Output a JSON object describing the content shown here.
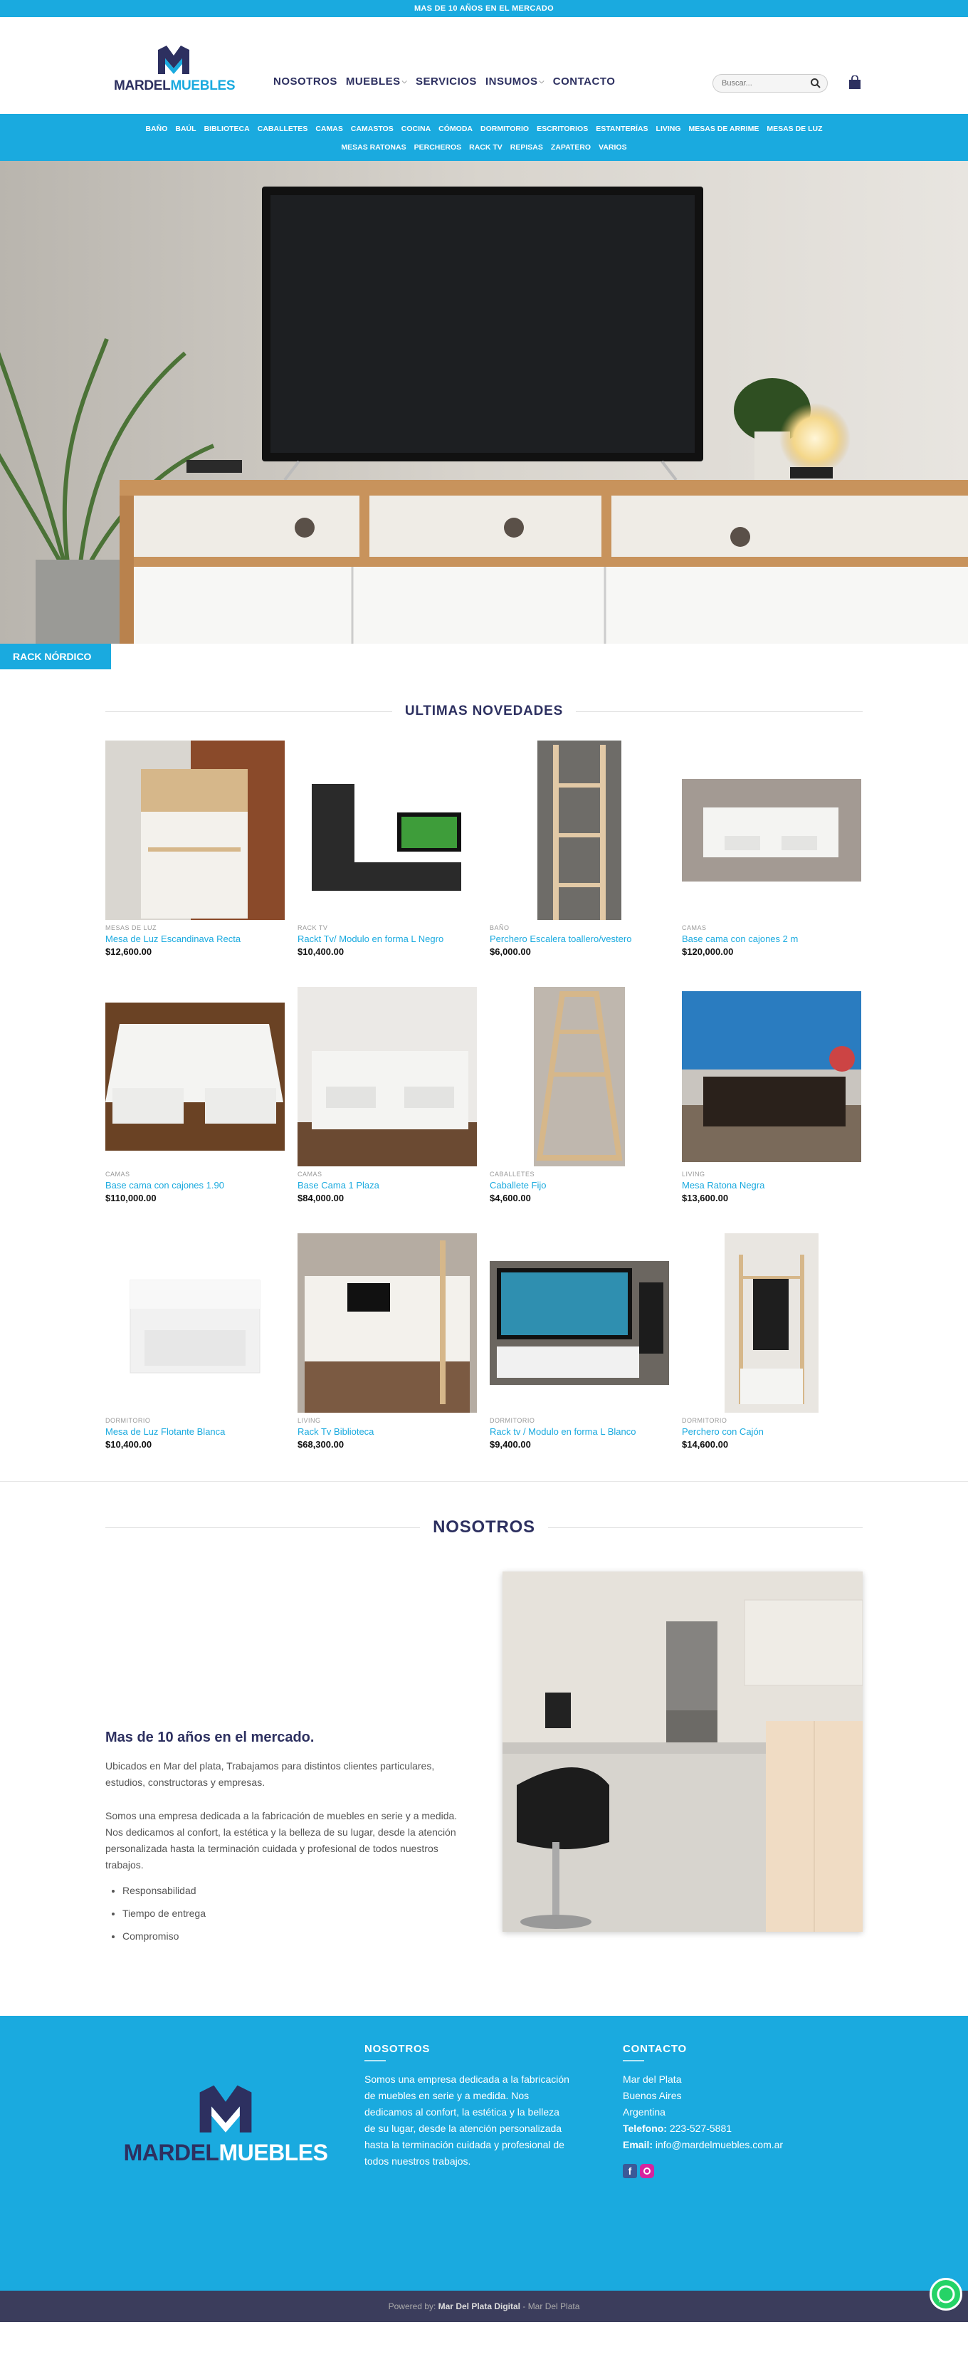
{
  "topbar": {
    "text": "MAS DE 10 AÑOS EN EL MERCADO"
  },
  "brand": {
    "part1": "MARDEL",
    "part2": "MUEBLES",
    "colors": {
      "navy": "#2d3060",
      "blue": "#1aaadf"
    }
  },
  "nav": {
    "items": [
      {
        "label": "NOSOTROS",
        "has_dropdown": false
      },
      {
        "label": "MUEBLES",
        "has_dropdown": true
      },
      {
        "label": "SERVICIOS",
        "has_dropdown": false
      },
      {
        "label": "INSUMOS",
        "has_dropdown": true
      },
      {
        "label": "CONTACTO",
        "has_dropdown": false
      }
    ],
    "search_placeholder": "Buscar...",
    "search_icon": "search-icon",
    "cart_icon": "shopping-bag-icon"
  },
  "categories": {
    "row1": [
      "BAÑO",
      "BAÚL",
      "BIBLIOTECA",
      "CABALLETES",
      "CAMAS",
      "CAMASTOS",
      "COCINA",
      "CÓMODA",
      "DORMITORIO",
      "ESCRITORIOS",
      "ESTANTERÍAS",
      "LIVING",
      "MESAS DE ARRIME",
      "MESAS DE LUZ"
    ],
    "row2": [
      "MESAS RATONAS",
      "PERCHEROS",
      "RACK TV",
      "REPISAS",
      "ZAPATERO",
      "VARIOS"
    ]
  },
  "hero": {
    "tag": "RACK NÓRDICO"
  },
  "latest": {
    "title": "ULTIMAS NOVEDADES",
    "products": [
      {
        "category": "MESAS DE LUZ",
        "name": "Mesa de Luz Escandinava Recta",
        "price": "$12,600.00"
      },
      {
        "category": "RACK TV",
        "name": "Rackt Tv/ Modulo en forma L Negro",
        "price": "$10,400.00"
      },
      {
        "category": "BAÑO",
        "name": "Perchero Escalera toallero/vestero",
        "price": "$6,000.00"
      },
      {
        "category": "CAMAS",
        "name": "Base cama con cajones 2 m",
        "price": "$120,000.00"
      },
      {
        "category": "CAMAS",
        "name": "Base cama con cajones 1.90",
        "price": "$110,000.00"
      },
      {
        "category": "CAMAS",
        "name": "Base Cama 1 Plaza",
        "price": "$84,000.00"
      },
      {
        "category": "CABALLETES",
        "name": "Caballete Fijo",
        "price": "$4,600.00"
      },
      {
        "category": "LIVING",
        "name": "Mesa Ratona Negra",
        "price": "$13,600.00"
      },
      {
        "category": "DORMITORIO",
        "name": "Mesa de Luz Flotante Blanca",
        "price": "$10,400.00"
      },
      {
        "category": "LIVING",
        "name": "Rack Tv Biblioteca",
        "price": "$68,300.00"
      },
      {
        "category": "DORMITORIO",
        "name": "Rack tv / Modulo en forma L Blanco",
        "price": "$9,400.00"
      },
      {
        "category": "DORMITORIO",
        "name": "Perchero con Cajón",
        "price": "$14,600.00"
      }
    ]
  },
  "about": {
    "title": "NOSOTROS",
    "heading": "Mas de 10 años en el mercado.",
    "p1": "Ubicados en Mar del plata, Trabajamos para distintos clientes particulares, estudios, constructoras y empresas.",
    "p2": "Somos una empresa dedicada a la fabricación de muebles en serie y a medida. Nos dedicamos al confort, la estética y la belleza de su lugar, desde la atención personalizada hasta la terminación cuidada y profesional de todos nuestros trabajos.",
    "bullets": [
      "Responsabilidad",
      "Tiempo de entrega",
      "Compromiso"
    ]
  },
  "footer": {
    "nosotros_title": "NOSOTROS",
    "nosotros_text": "Somos una empresa dedicada a la fabricación de muebles en serie y a medida. Nos dedicamos al confort, la estética y la belleza de su lugar, desde la atención personalizada hasta la terminación cuidada y profesional de todos nuestros trabajos.",
    "contacto_title": "CONTACTO",
    "city": "Mar del Plata",
    "province": "Buenos Aires",
    "country": "Argentina",
    "phone_label": "Telefono:",
    "phone": "223-527-5881",
    "email_label": "Email:",
    "email": "info@mardelmuebles.com.ar",
    "social_icons": [
      "facebook-icon",
      "instagram-icon"
    ]
  },
  "bottom": {
    "powered": "Powered by:",
    "company": "Mar Del Plata Digital",
    "suffix": "- Mar Del Plata"
  }
}
